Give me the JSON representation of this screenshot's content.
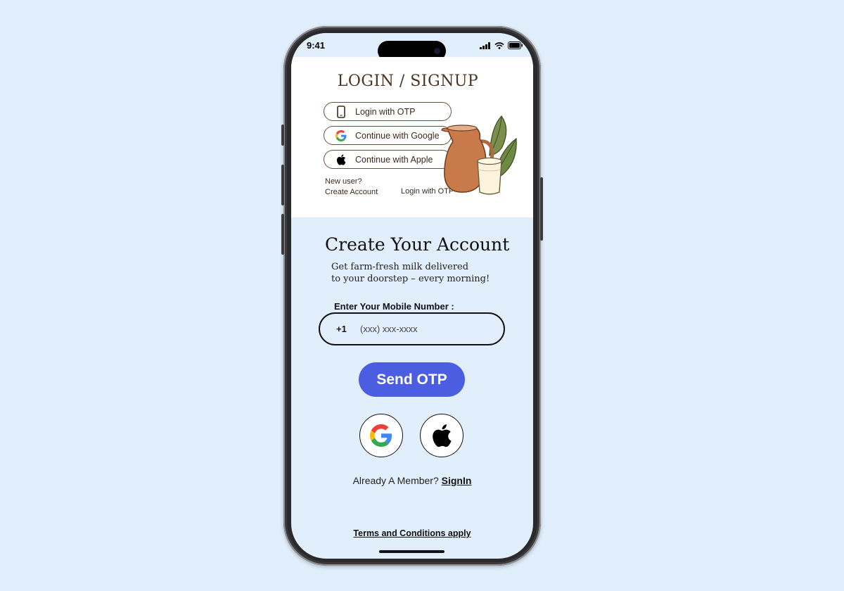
{
  "status_bar": {
    "time": "9:41"
  },
  "hero": {
    "title": "LOGIN / SIGNUP",
    "options": [
      {
        "label": "Login with OTP",
        "icon": "phone-icon"
      },
      {
        "label": "Continue with Google",
        "icon": "google-icon"
      },
      {
        "label": "Continue with Apple",
        "icon": "apple-icon"
      }
    ],
    "new_user_line1": "New user?",
    "new_user_line2": "Create Account",
    "login_otp_link": "Login with OTP"
  },
  "main": {
    "heading": "Create Your Account",
    "subtitle_line1": "Get farm-fresh milk delivered",
    "subtitle_line2": "to your doorstep – every morning!",
    "phone_label": "Enter Your Mobile Number :",
    "country_code": "+1",
    "phone_placeholder": "(xxx) xxx-xxxx",
    "send_otp_label": "Send OTP",
    "member_text": "Already A Member?",
    "signin_label": "SignIn",
    "terms_label": "Terms and Conditions apply"
  },
  "colors": {
    "background": "#e1effc",
    "primary_button": "#4b5de0",
    "brand_brown": "#4a3423"
  }
}
